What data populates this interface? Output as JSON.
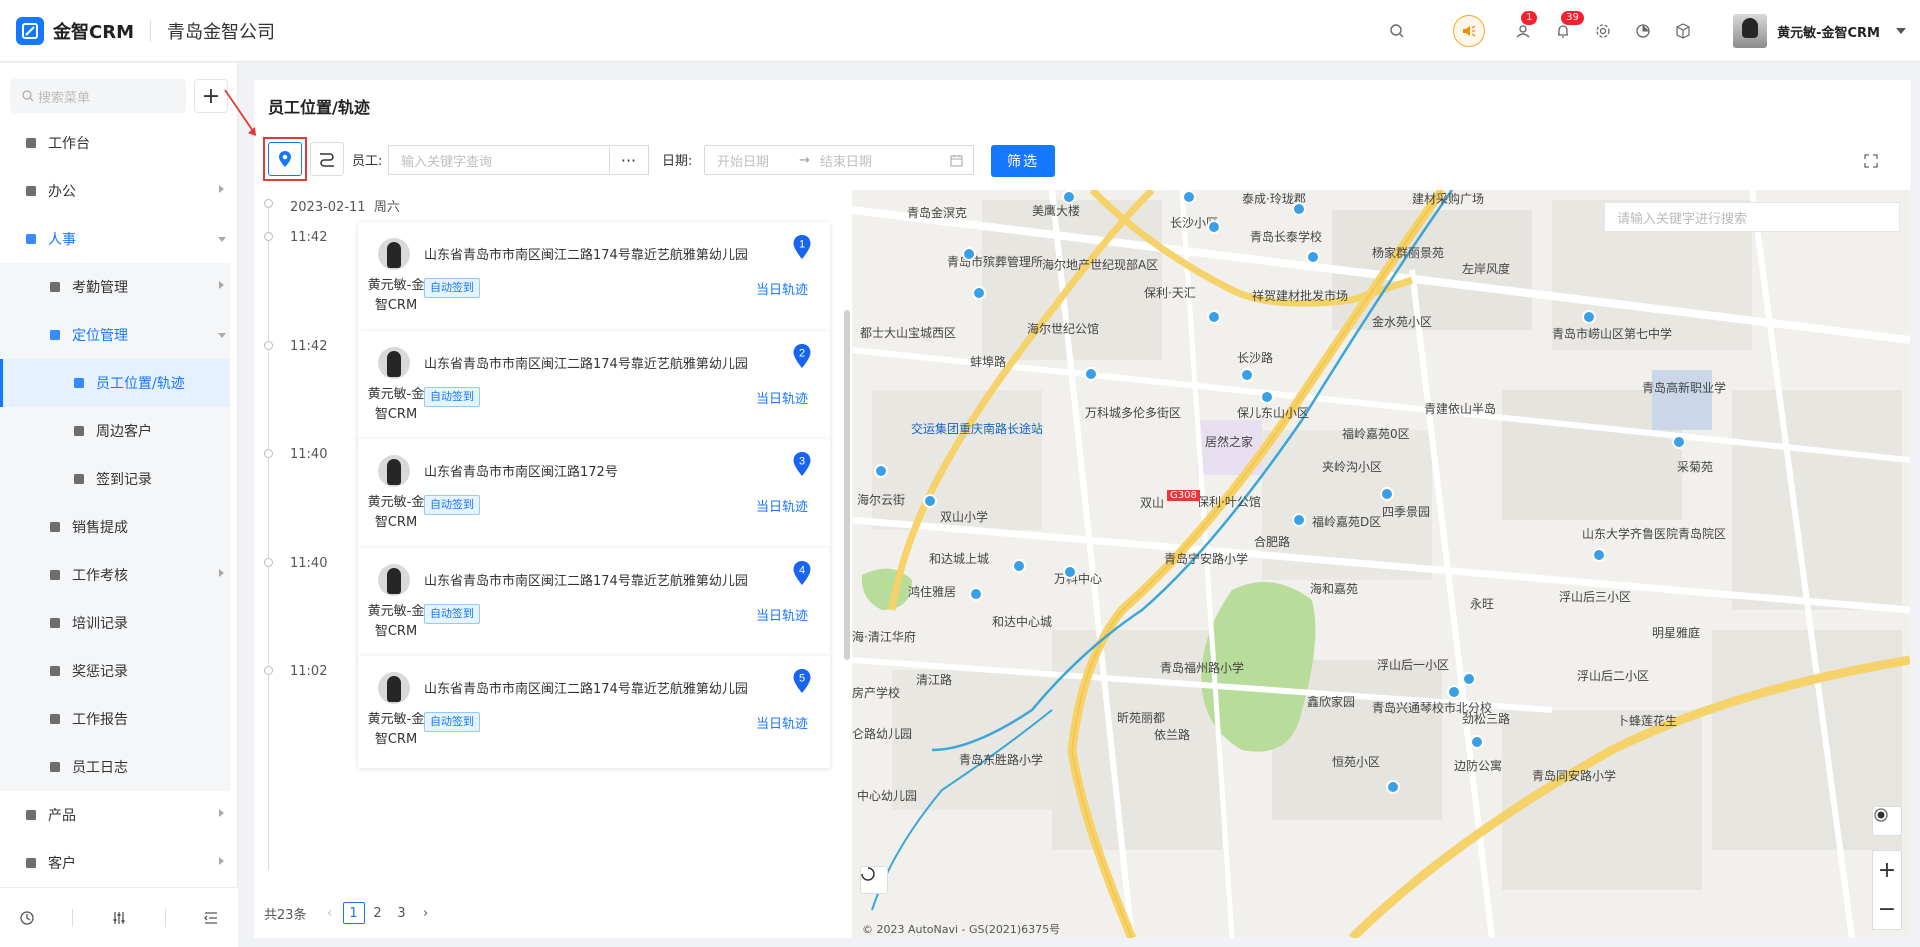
{
  "header": {
    "brand": "金智CRM",
    "company": "青岛金智公司",
    "mail_badge": "1",
    "bell_badge": "39",
    "user_name": "黄元敏-金智CRM",
    "icons": [
      "search-icon",
      "speaker-icon",
      "mail-icon",
      "bell-icon",
      "gear-icon",
      "pie-chart-icon",
      "box-icon",
      "chevron-down-icon"
    ]
  },
  "sidebar": {
    "search_placeholder": "搜索菜单",
    "add_label": "+",
    "items": [
      {
        "label": "工作台",
        "level": 1,
        "icon": "dashboard-icon"
      },
      {
        "label": "办公",
        "level": 1,
        "icon": "monitor-icon",
        "arrow": "right"
      },
      {
        "label": "人事",
        "level": 1,
        "icon": "people-icon",
        "arrow": "down",
        "blue": true
      },
      {
        "label": "考勤管理",
        "level": 2,
        "icon": "folder-icon",
        "arrow": "right"
      },
      {
        "label": "定位管理",
        "level": 2,
        "icon": "folder-icon",
        "arrow": "down",
        "blue": true
      },
      {
        "label": "员工位置/轨迹",
        "level": 3,
        "icon": "location-icon",
        "active": true
      },
      {
        "label": "周边客户",
        "level": 3,
        "icon": "location-icon"
      },
      {
        "label": "签到记录",
        "level": 3,
        "icon": "location-icon"
      },
      {
        "label": "销售提成",
        "level": 2,
        "icon": "coin-icon"
      },
      {
        "label": "工作考核",
        "level": 2,
        "icon": "folder-icon",
        "arrow": "right"
      },
      {
        "label": "培训记录",
        "level": 2,
        "icon": "edit-icon"
      },
      {
        "label": "奖惩记录",
        "level": 2,
        "icon": "medal-icon"
      },
      {
        "label": "工作报告",
        "level": 2,
        "icon": "edit-icon"
      },
      {
        "label": "员工日志",
        "level": 2,
        "icon": "doc-icon"
      },
      {
        "label": "产品",
        "level": 1,
        "icon": "box-icon",
        "arrow": "right"
      },
      {
        "label": "客户",
        "level": 1,
        "icon": "user-icon",
        "arrow": "right"
      }
    ],
    "bottom_icons": [
      "history-icon",
      "sliders-icon",
      "collapse-menu-icon"
    ]
  },
  "page": {
    "title": "员工位置/轨迹",
    "employee_label": "员工:",
    "employee_placeholder": "输入关键字查询",
    "more_label": "···",
    "date_label": "日期:",
    "start_placeholder": "开始日期",
    "end_placeholder": "结束日期",
    "date_arrow": "→",
    "filter_label": "筛选"
  },
  "timeline": {
    "date": "2023-02-11",
    "weekday": "周六",
    "records": [
      {
        "time": "11:42",
        "address": "山东省青岛市市南区闽江二路174号靠近艺航雅第幼儿园",
        "name": "黄元敏-金智CRM",
        "tag": "自动签到",
        "link": "当日轨迹",
        "num": "1"
      },
      {
        "time": "11:42",
        "address": "山东省青岛市市南区闽江二路174号靠近艺航雅第幼儿园",
        "name": "黄元敏-金智CRM",
        "tag": "自动签到",
        "link": "当日轨迹",
        "num": "2"
      },
      {
        "time": "11:40",
        "address": "山东省青岛市市南区闽江路172号",
        "name": "黄元敏-金智CRM",
        "tag": "自动签到",
        "link": "当日轨迹",
        "num": "3"
      },
      {
        "time": "11:40",
        "address": "山东省青岛市市南区闽江二路174号靠近艺航雅第幼儿园",
        "name": "黄元敏-金智CRM",
        "tag": "自动签到",
        "link": "当日轨迹",
        "num": "4"
      },
      {
        "time": "11:02",
        "address": "山东省青岛市市南区闽江二路174号靠近艺航雅第幼儿园",
        "name": "黄元敏-金智CRM",
        "tag": "自动签到",
        "link": "当日轨迹",
        "num": "5"
      }
    ]
  },
  "pager": {
    "total": "共23条",
    "pages": [
      "1",
      "2",
      "3"
    ],
    "current": "1",
    "prev": "‹",
    "next": "›"
  },
  "map": {
    "search_placeholder": "请输入关键字进行搜索",
    "copyright": "© 2023 AutoNavi - GS(2021)6375号",
    "zoom_in": "+",
    "zoom_out": "−",
    "labels": [
      {
        "text": "青岛金溟克",
        "blue": false
      },
      {
        "text": "美鹰大楼",
        "blue": false
      },
      {
        "text": "长沙小区",
        "blue": false
      },
      {
        "text": "泰成·玲珑郡",
        "blue": false
      },
      {
        "text": "建材采购广场",
        "blue": false
      },
      {
        "text": "青岛市殡葬管理所",
        "blue": false
      },
      {
        "text": "海尔地产世纪现部A区",
        "blue": false
      },
      {
        "text": "青岛长泰学校",
        "blue": false
      },
      {
        "text": "杨家群丽景苑",
        "blue": false
      },
      {
        "text": "保利·天汇",
        "blue": false
      },
      {
        "text": "祥贺建材批发市场",
        "blue": false
      },
      {
        "text": "金水苑小区",
        "blue": false
      },
      {
        "text": "左岸风度",
        "blue": false
      },
      {
        "text": "都士大山宝城西区",
        "blue": false
      },
      {
        "text": "海尔世纪公馆",
        "blue": false
      },
      {
        "text": "长沙路",
        "blue": false
      },
      {
        "text": "青岛市崂山区第七中学",
        "blue": false
      },
      {
        "text": "蚌埠路",
        "blue": false
      },
      {
        "text": "青岛高新职业学",
        "blue": false
      },
      {
        "text": "万科城多伦多街区",
        "blue": false
      },
      {
        "text": "保儿东山小区",
        "blue": false
      },
      {
        "text": "青建依山半岛",
        "blue": false
      },
      {
        "text": "交运集团重庆南路长途站",
        "blue": true
      },
      {
        "text": "居然之家",
        "blue": false
      },
      {
        "text": "福岭嘉苑0区",
        "blue": false
      },
      {
        "text": "夹岭沟小区",
        "blue": false
      },
      {
        "text": "采菊苑",
        "blue": false
      },
      {
        "text": "海尔云街",
        "blue": false
      },
      {
        "text": "双山",
        "blue": false
      },
      {
        "text": "保利·叶公馆",
        "blue": false
      },
      {
        "text": "双山小学",
        "blue": false
      },
      {
        "text": "福岭嘉苑D区",
        "blue": false
      },
      {
        "text": "四季景园",
        "blue": false
      },
      {
        "text": "山东大学齐鲁医院青岛院区",
        "blue": false
      },
      {
        "text": "和达城上城",
        "blue": false
      },
      {
        "text": "青岛宁安路小学",
        "blue": false
      },
      {
        "text": "合肥路",
        "blue": false
      },
      {
        "text": "鸿住雅居",
        "blue": false
      },
      {
        "text": "万科中心",
        "blue": false
      },
      {
        "text": "海和嘉苑",
        "blue": false
      },
      {
        "text": "永旺",
        "blue": false
      },
      {
        "text": "浮山后三小区",
        "blue": false
      },
      {
        "text": "和达中心城",
        "blue": false
      },
      {
        "text": "明星雅庭",
        "blue": false
      },
      {
        "text": "海·清江华府",
        "blue": false
      },
      {
        "text": "浮山后一小区",
        "blue": false
      },
      {
        "text": "清江路",
        "blue": false
      },
      {
        "text": "青岛福州路小学",
        "blue": false
      },
      {
        "text": "浮山后二小区",
        "blue": false
      },
      {
        "text": "房产学校",
        "blue": false
      },
      {
        "text": "鑫欣家园",
        "blue": false
      },
      {
        "text": "昕苑丽都",
        "blue": false
      },
      {
        "text": "青岛兴通琴校市北分校",
        "blue": false
      },
      {
        "text": "劲松三路",
        "blue": false
      },
      {
        "text": "卜蜂莲花生",
        "blue": false
      },
      {
        "text": "仑路幼儿园",
        "blue": false
      },
      {
        "text": "依兰路",
        "blue": false
      },
      {
        "text": "青岛东胜路小学",
        "blue": false
      },
      {
        "text": "恒苑小区",
        "blue": false
      },
      {
        "text": "边防公寓",
        "blue": false
      },
      {
        "text": "青岛同安路小学",
        "blue": false
      },
      {
        "text": "中心幼儿园",
        "blue": false
      },
      {
        "text": "G308",
        "blue": false
      }
    ]
  }
}
